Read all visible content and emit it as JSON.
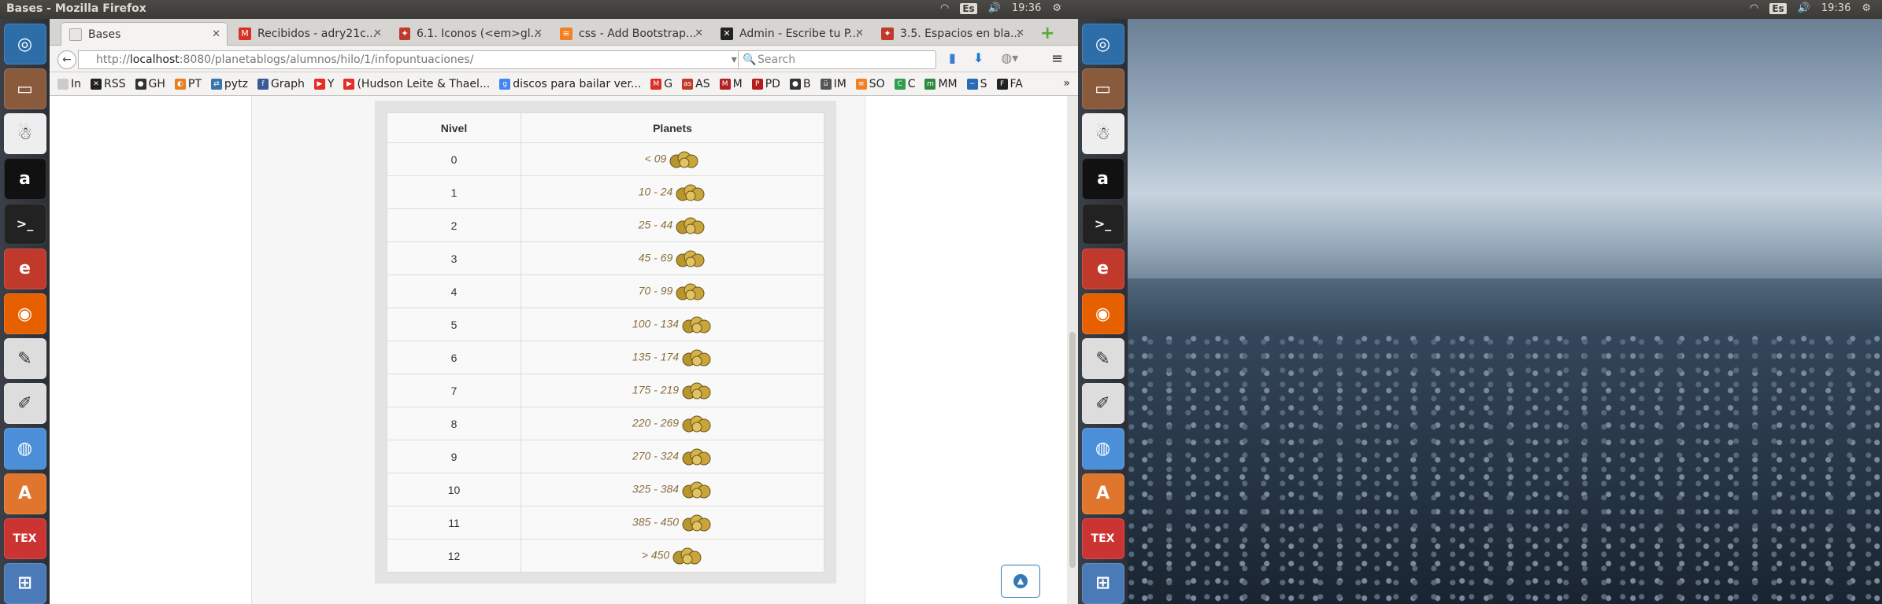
{
  "window": {
    "title": "Bases - Mozilla Firefox"
  },
  "clock": "19:36",
  "keyboard": "Es",
  "tabs": [
    {
      "label": "Bases",
      "color": "#e8e6e3"
    },
    {
      "label": "Recibidos - adry21c...",
      "color": "#d93025"
    },
    {
      "label": "6.1.  Iconos (<em>gl...",
      "color": "#c0392b"
    },
    {
      "label": "css - Add Bootstrap...",
      "color": "#f48024"
    },
    {
      "label": "Admin - Escribe tu P...",
      "color": "#222222"
    },
    {
      "label": "3.5. Espacios en bla...",
      "color": "#c0392b"
    }
  ],
  "address": {
    "host": "localhost",
    "rest": ":8080/planetablogs/alumnos/hilo/1/infopuntuaciones/",
    "prefix": "http://"
  },
  "search": {
    "placeholder": "Search"
  },
  "bookmarks": [
    {
      "label": "In",
      "icon": "page-icon"
    },
    {
      "label": "RSS",
      "icon": "x-icon"
    },
    {
      "label": "GH",
      "icon": "github-icon"
    },
    {
      "label": "PT",
      "icon": "pt-icon"
    },
    {
      "label": "pytz",
      "icon": "pytz-icon"
    },
    {
      "label": "Graph",
      "icon": "graph-icon"
    },
    {
      "label": "Y",
      "icon": "youtube-icon"
    },
    {
      "label": "(Hudson Leite & Thael...",
      "icon": "youtube-icon"
    },
    {
      "label": "discos para bailar ver...",
      "icon": "google-icon"
    },
    {
      "label": "G",
      "icon": "gmail-icon"
    },
    {
      "label": "AS",
      "icon": "as-icon"
    },
    {
      "label": "M",
      "icon": "m-icon"
    },
    {
      "label": "PD",
      "icon": "pd-icon"
    },
    {
      "label": "B",
      "icon": "github-icon"
    },
    {
      "label": "IM",
      "icon": "im-icon"
    },
    {
      "label": "SO",
      "icon": "so-icon"
    },
    {
      "label": "C",
      "icon": "c-icon"
    },
    {
      "label": "MM",
      "icon": "mm-icon"
    },
    {
      "label": "S",
      "icon": "s-icon"
    },
    {
      "label": "FA",
      "icon": "fa-icon"
    }
  ],
  "table": {
    "headers": [
      "Nivel",
      "Planets"
    ],
    "rows": [
      {
        "nivel": "0",
        "range": "< 09"
      },
      {
        "nivel": "1",
        "range": "10 - 24"
      },
      {
        "nivel": "2",
        "range": "25 - 44"
      },
      {
        "nivel": "3",
        "range": "45 - 69"
      },
      {
        "nivel": "4",
        "range": "70 - 99"
      },
      {
        "nivel": "5",
        "range": "100 - 134"
      },
      {
        "nivel": "6",
        "range": "135 - 174"
      },
      {
        "nivel": "7",
        "range": "175 - 219"
      },
      {
        "nivel": "8",
        "range": "220 - 269"
      },
      {
        "nivel": "9",
        "range": "270 - 324"
      },
      {
        "nivel": "10",
        "range": "325 - 384"
      },
      {
        "nivel": "11",
        "range": "385 - 450"
      },
      {
        "nivel": "12",
        "range": "> 450"
      }
    ]
  }
}
